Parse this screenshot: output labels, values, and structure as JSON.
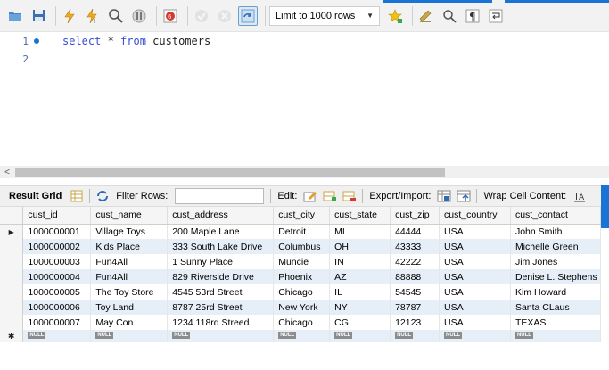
{
  "toolbar": {
    "limit_label": "Limit to 1000 rows"
  },
  "editor": {
    "lines": [
      {
        "num": "1",
        "kw1": "select",
        "mid": " * ",
        "kw2": "from",
        "rest": " customers"
      },
      {
        "num": "2"
      }
    ]
  },
  "result_bar": {
    "result_grid_label": "Result Grid",
    "filter_rows_label": "Filter Rows:",
    "filter_value": "",
    "edit_label": "Edit:",
    "export_import_label": "Export/Import:",
    "wrap_label": "Wrap Cell Content:"
  },
  "grid": {
    "columns": [
      "cust_id",
      "cust_name",
      "cust_address",
      "cust_city",
      "cust_state",
      "cust_zip",
      "cust_country",
      "cust_contact"
    ],
    "rows": [
      [
        "1000000001",
        "Village Toys",
        "200 Maple Lane",
        "Detroit",
        "MI",
        "44444",
        "USA",
        "John Smith"
      ],
      [
        "1000000002",
        "Kids Place",
        "333 South Lake Drive",
        "Columbus",
        "OH",
        "43333",
        "USA",
        "Michelle Green"
      ],
      [
        "1000000003",
        "Fun4All",
        "1 Sunny Place",
        "Muncie",
        "IN",
        "42222",
        "USA",
        "Jim Jones"
      ],
      [
        "1000000004",
        "Fun4All",
        "829 Riverside Drive",
        "Phoenix",
        "AZ",
        "88888",
        "USA",
        "Denise L. Stephens"
      ],
      [
        "1000000005",
        "The Toy Store",
        "4545 53rd Street",
        "Chicago",
        "IL",
        "54545",
        "USA",
        "Kim Howard"
      ],
      [
        "1000000006",
        "Toy Land",
        "8787 25rd Street",
        "New York",
        "NY",
        "78787",
        "USA",
        "Santa CLaus"
      ],
      [
        "1000000007",
        "May Con",
        "1234 118rd Streed",
        "Chicago",
        "CG",
        "12123",
        "USA",
        "TEXAS"
      ]
    ],
    "null_label": "NULL"
  }
}
